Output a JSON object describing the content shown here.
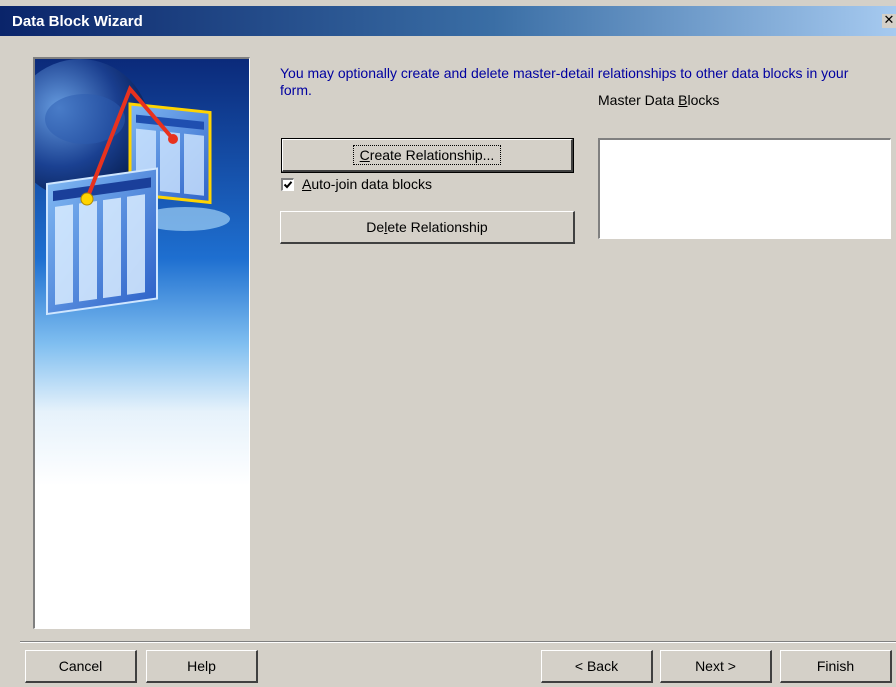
{
  "window": {
    "title": "Data Block Wizard",
    "close_glyph": "✕"
  },
  "main": {
    "instructions": "You may optionally create and delete master-detail relationships to other data blocks in your form.",
    "create_relationship": {
      "pre": "",
      "key": "C",
      "post": "reate Relationship..."
    },
    "auto_join": {
      "pre": "",
      "key": "A",
      "post": "uto-join data blocks",
      "checked": true
    },
    "delete_relationship": {
      "pre": "De",
      "key": "l",
      "post": "ete Relationship"
    },
    "master_blocks_label": {
      "pre": "Master Data ",
      "key": "B",
      "post": "locks"
    },
    "master_blocks_items": []
  },
  "footer": {
    "cancel": "Cancel",
    "help": "Help",
    "back": "< Back",
    "next": "Next >",
    "finish": "Finish"
  },
  "colors": {
    "dialog_bg": "#d4d0c8",
    "title_start": "#0a246a",
    "title_end": "#a6caf0",
    "instruction_text": "#0000a0"
  }
}
